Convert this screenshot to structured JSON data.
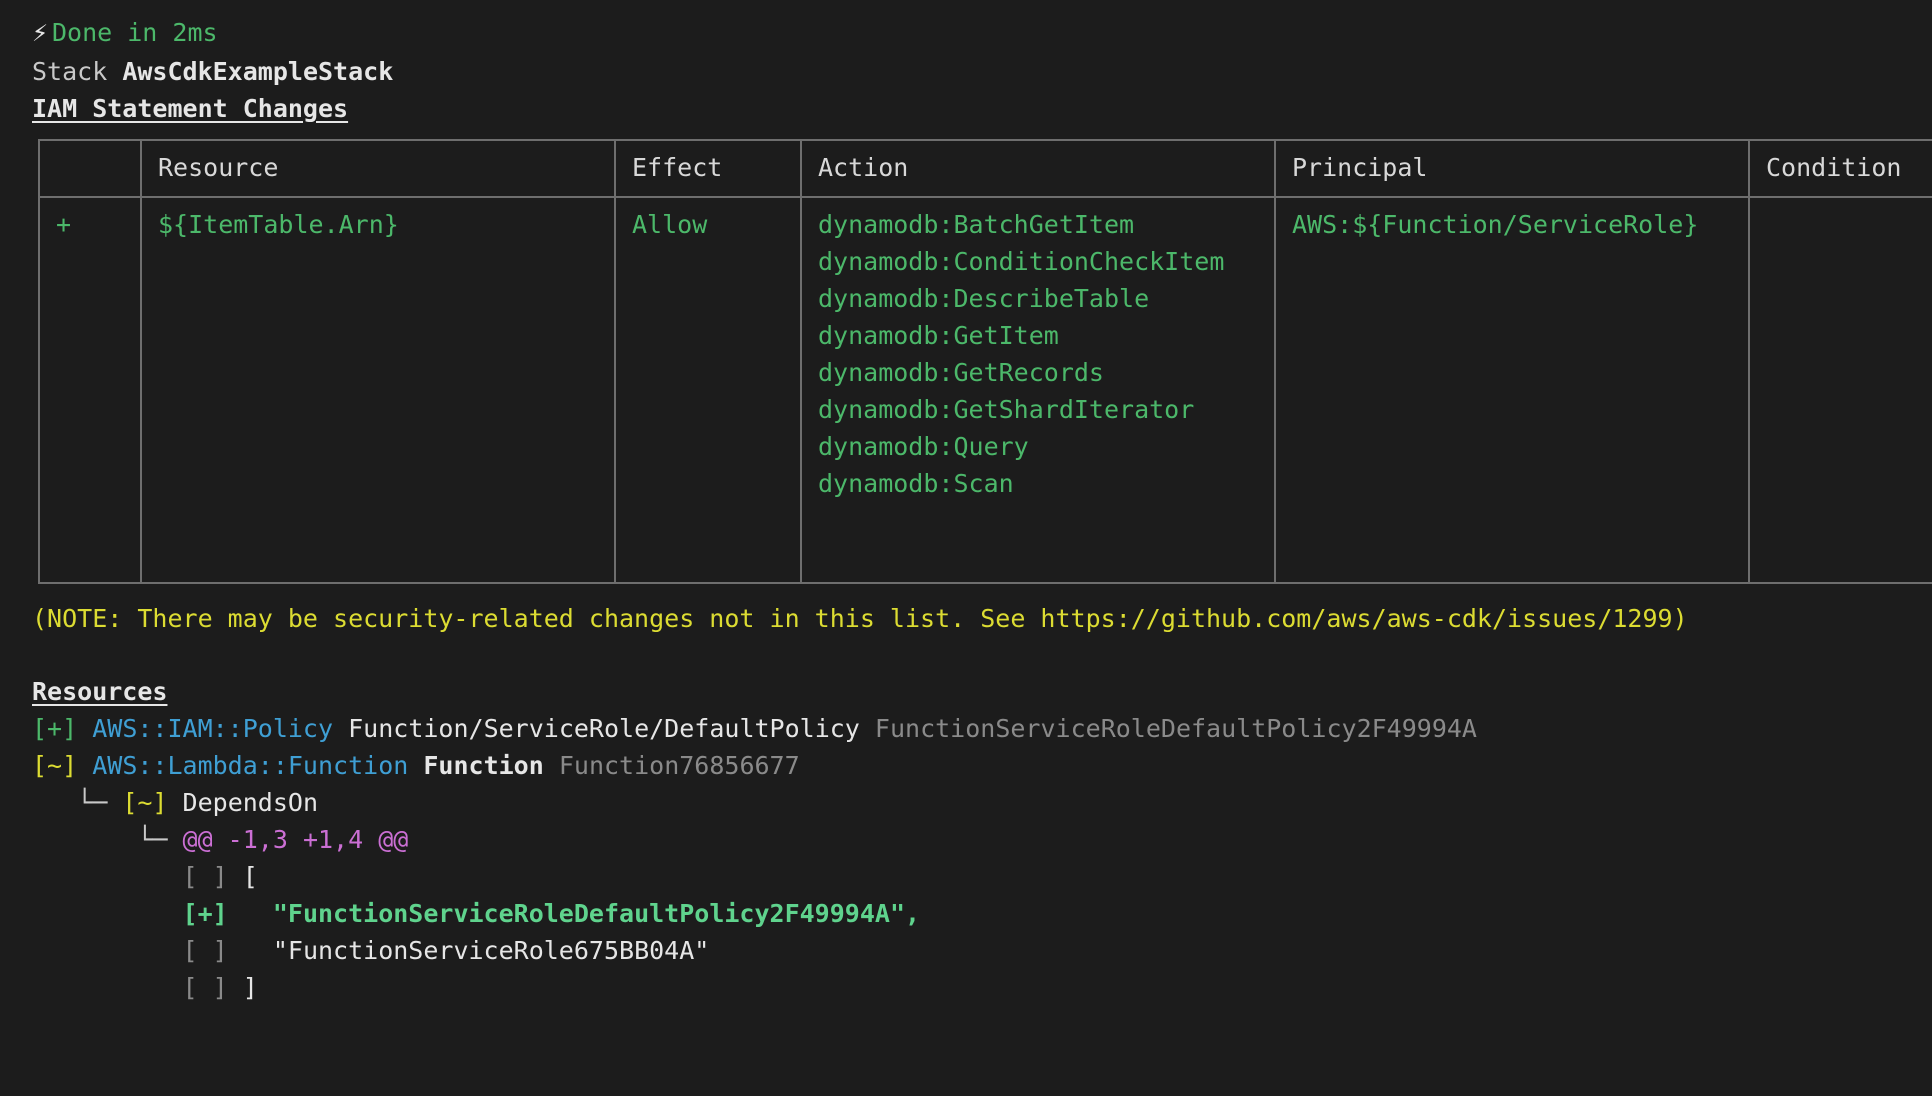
{
  "theme": {
    "background": "#1c1c1c",
    "border": "#6e6e6e",
    "green": "#4cb86a",
    "green_bright": "#5fd38d",
    "yellow": "#dcdc32",
    "blue": "#3f9fd4",
    "magenta": "#cb6fd4",
    "white": "#e6e6e6",
    "dim": "#8a8a8a"
  },
  "status": {
    "icon": "lightning-bolt-icon",
    "glyph": "⚡",
    "text": "Done in 2ms"
  },
  "stack": {
    "label": "Stack",
    "name": "AwsCdkExampleStack"
  },
  "iam_section": {
    "heading": "IAM Statement Changes",
    "columns": [
      "",
      "Resource",
      "Effect",
      "Action",
      "Principal",
      "Condition"
    ],
    "rows": [
      {
        "sign": "+",
        "resource": "${ItemTable.Arn}",
        "effect": "Allow",
        "action": "dynamodb:BatchGetItem\ndynamodb:ConditionCheckItem\ndynamodb:DescribeTable\ndynamodb:GetItem\ndynamodb:GetRecords\ndynamodb:GetShardIterator\ndynamodb:Query\ndynamodb:Scan",
        "principal": "AWS:${Function/ServiceRole}",
        "condition": ""
      }
    ],
    "note": "(NOTE: There may be security-related changes not in this list. See https://github.com/aws/aws-cdk/issues/1299)"
  },
  "resources_section": {
    "heading": "Resources",
    "entries": [
      {
        "marker": "[+]",
        "marker_kind": "add",
        "type": "AWS::IAM::Policy",
        "path": "Function/ServiceRole/DefaultPolicy",
        "logical_id": "FunctionServiceRoleDefaultPolicy2F49994A"
      },
      {
        "marker": "[~]",
        "marker_kind": "update",
        "type": "AWS::Lambda::Function",
        "path": "Function",
        "logical_id": "Function76856677"
      }
    ],
    "child": {
      "branch": "└─",
      "marker": "[~]",
      "label": "DependsOn"
    },
    "hunk": {
      "branch": "└─",
      "header": "@@ -1,3 +1,4 @@"
    },
    "diff_lines": [
      {
        "marker": "[ ]",
        "kind": "context",
        "text": "["
      },
      {
        "marker": "[+]",
        "kind": "add",
        "text": "  \"FunctionServiceRoleDefaultPolicy2F49994A\","
      },
      {
        "marker": "[ ]",
        "kind": "context",
        "text": "  \"FunctionServiceRole675BB04A\""
      },
      {
        "marker": "[ ]",
        "kind": "context",
        "text": "]"
      }
    ]
  }
}
